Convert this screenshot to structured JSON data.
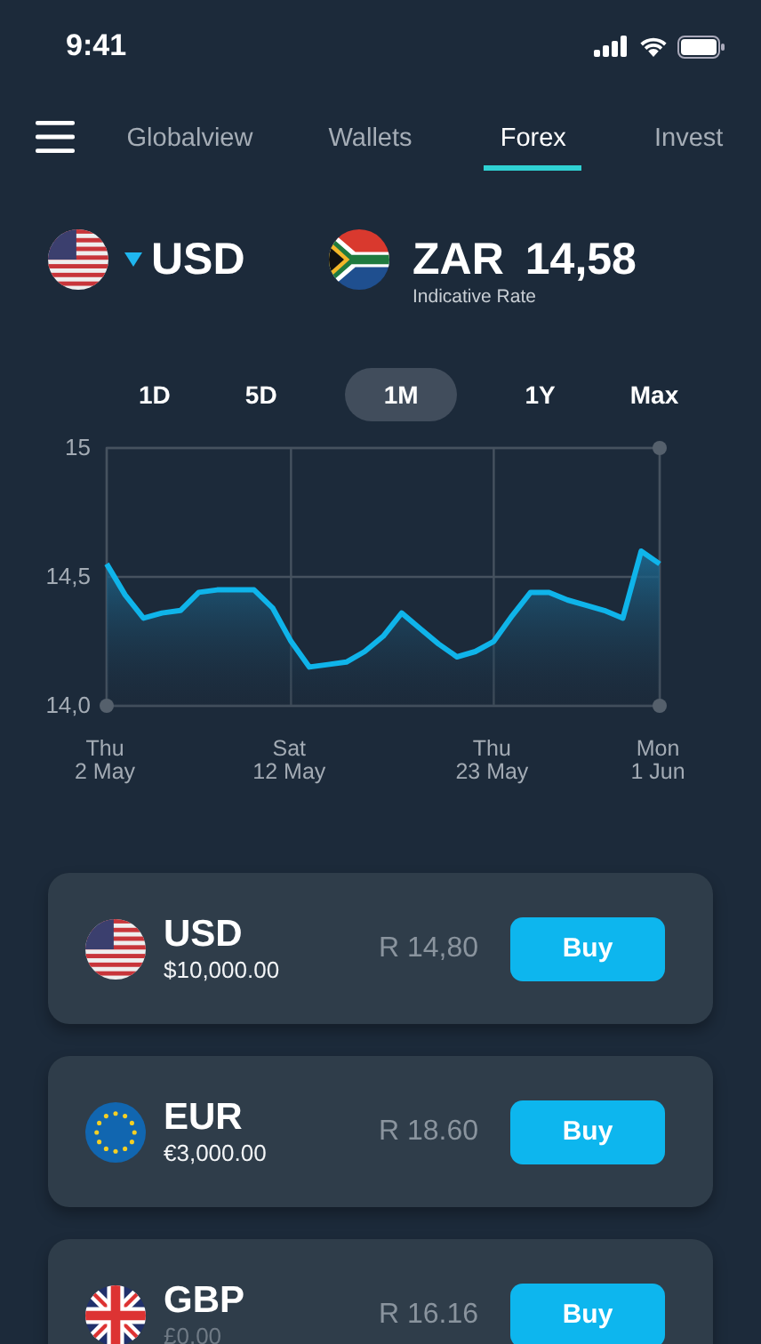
{
  "status_bar": {
    "time": "9:41"
  },
  "nav": {
    "tabs": [
      {
        "label": "Globalview",
        "selected": false
      },
      {
        "label": "Wallets",
        "selected": false
      },
      {
        "label": "Forex",
        "selected": true
      },
      {
        "label": "Invest",
        "selected": false
      }
    ]
  },
  "pair": {
    "base": "USD",
    "quote": "ZAR",
    "rate": "14,58",
    "caption": "Indicative Rate"
  },
  "ranges": [
    {
      "label": "1D",
      "selected": false
    },
    {
      "label": "5D",
      "selected": false
    },
    {
      "label": "1M",
      "selected": true
    },
    {
      "label": "1Y",
      "selected": false
    },
    {
      "label": "Max",
      "selected": false
    }
  ],
  "chart_data": {
    "type": "area",
    "grid": true,
    "ylim": [
      14,
      15
    ],
    "categories": [
      "Thu 2 May",
      null,
      null,
      null,
      null,
      null,
      null,
      null,
      null,
      null,
      "Sat 12 May",
      null,
      null,
      null,
      null,
      null,
      null,
      null,
      null,
      null,
      null,
      "Thu 23 May",
      null,
      null,
      null,
      null,
      null,
      null,
      null,
      null,
      "Mon 1 Jun"
    ],
    "series": [
      {
        "color": "#0fb4ea",
        "values": [
          14.55,
          14.43,
          14.34,
          14.36,
          14.37,
          14.44,
          14.45,
          14.45,
          14.45,
          14.38,
          14.25,
          14.15,
          14.16,
          14.17,
          14.21,
          14.27,
          14.36,
          14.3,
          14.24,
          14.19,
          14.21,
          14.25,
          14.35,
          14.44,
          14.44,
          14.41,
          14.39,
          14.37,
          14.34,
          14.6,
          14.55
        ]
      }
    ],
    "yticks": [
      {
        "value": 15,
        "label": "15"
      },
      {
        "value": 14.5,
        "label": "14,5"
      },
      {
        "value": 14,
        "label": "14,0"
      }
    ]
  },
  "wallets": [
    {
      "code": "USD",
      "balance": "$10,000.00",
      "balance_muted": false,
      "rate": "R 14,80",
      "action": "Buy"
    },
    {
      "code": "EUR",
      "balance": "€3,000.00",
      "balance_muted": false,
      "rate": "R 18.60",
      "action": "Buy"
    },
    {
      "code": "GBP",
      "balance": "£0.00",
      "balance_muted": true,
      "rate": "R 16.16",
      "action": "Buy"
    }
  ]
}
